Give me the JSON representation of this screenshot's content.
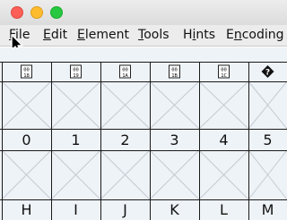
{
  "window": {
    "controls": [
      "close",
      "minimize",
      "zoom"
    ],
    "colors": {
      "close": "#fc5f57",
      "minimize": "#fdbc2e",
      "zoom": "#28c840"
    }
  },
  "menu": {
    "items": [
      {
        "label": "File",
        "mnemonic": "F"
      },
      {
        "label": "Edit",
        "mnemonic": "E"
      },
      {
        "label": "Element",
        "mnemonic": "E"
      },
      {
        "label": "Tools",
        "mnemonic": "T"
      },
      {
        "label": "Hints",
        "mnemonic": "i"
      },
      {
        "label": "Encoding",
        "mnemonic": "n"
      }
    ]
  },
  "cursor": {
    "icon": "arrow-cursor-icon",
    "hovering": "File"
  },
  "glyph_grid": {
    "top_header_codes": [
      "0018",
      "0019",
      "001A",
      "001B",
      "001C",
      "?"
    ],
    "row1_labels": [
      "0",
      "1",
      "2",
      "3",
      "4",
      "5"
    ],
    "row2_labels": [
      "H",
      "I",
      "J",
      "K",
      "L",
      "M"
    ],
    "colors": {
      "background": "#eef3f7",
      "grid_line": "#1a1a1a",
      "placeholder_cross": "#c4cad2"
    }
  }
}
